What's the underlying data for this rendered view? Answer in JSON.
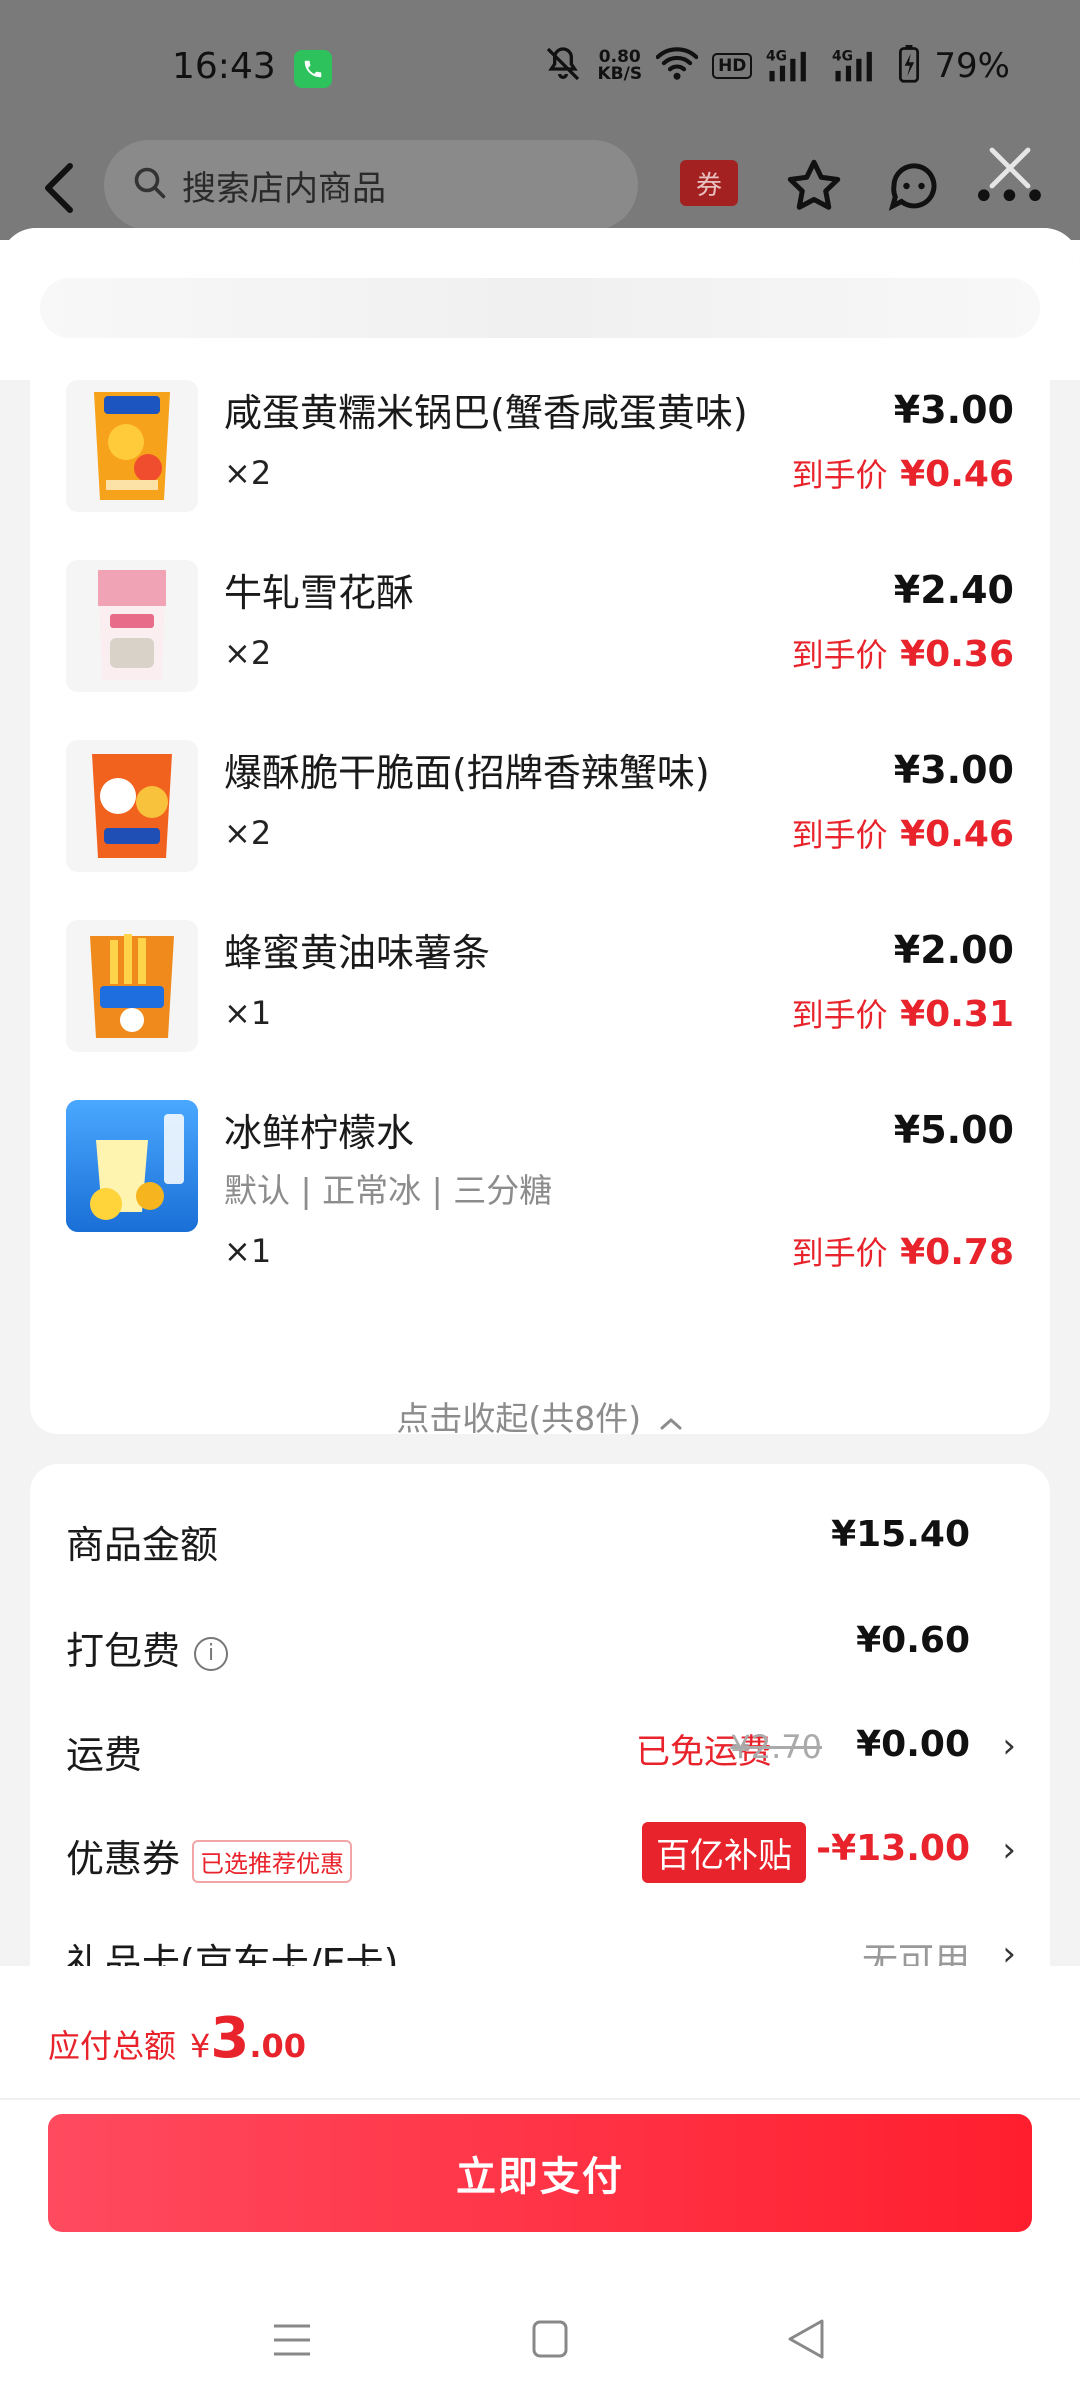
{
  "status_bar": {
    "time": "16:43",
    "net_speed_value": "0.80",
    "net_speed_unit": "KB/S",
    "hd_label": "HD",
    "network_1": "4G",
    "network_2": "4G",
    "battery": "79%"
  },
  "store_bar": {
    "search_placeholder": "搜索店内商品",
    "coupon_label": "券",
    "more_label": "•••"
  },
  "items": [
    {
      "name": "咸蛋黄糯米锅巴(蟹香咸蛋黄味)",
      "qty": "×2",
      "price": "¥3.00",
      "final_label": "到手价",
      "final_price": "¥0.46"
    },
    {
      "name": "牛轧雪花酥",
      "qty": "×2",
      "price": "¥2.40",
      "final_label": "到手价",
      "final_price": "¥0.36"
    },
    {
      "name": "爆酥脆干脆面(招牌香辣蟹味)",
      "qty": "×2",
      "price": "¥3.00",
      "final_label": "到手价",
      "final_price": "¥0.46"
    },
    {
      "name": "蜂蜜黄油味薯条",
      "qty": "×1",
      "price": "¥2.00",
      "final_label": "到手价",
      "final_price": "¥0.31"
    },
    {
      "name": "冰鲜柠檬水",
      "spec": "默认 | 正常冰 | 三分糖",
      "qty": "×1",
      "price": "¥5.00",
      "final_label": "到手价",
      "final_price": "¥0.78"
    }
  ],
  "collapse_text": "点击收起(共8件)",
  "fees": {
    "goods_label": "商品金额",
    "goods_value": "¥15.40",
    "packing_label": "打包费",
    "packing_value": "¥0.60",
    "shipping_label": "运费",
    "shipping_free_text": "已免运费",
    "shipping_original": "¥2.70",
    "shipping_value": "¥0.00",
    "coupon_label": "优惠券",
    "coupon_tag": "已选推荐优惠",
    "coupon_subsidy": "百亿补贴",
    "coupon_value": "-¥13.00",
    "giftcard_label": "礼品卡(京东卡/E卡)",
    "giftcard_value": "无可用"
  },
  "footer": {
    "total_label": "应付总额",
    "total_currency": "¥",
    "total_int": "3",
    "total_dec": ".00",
    "pay_button": "立即支付"
  },
  "colors": {
    "accent_red": "#e8232b",
    "pay_gradient_start": "#ff4a5f",
    "pay_gradient_end": "#ff1e2e"
  }
}
